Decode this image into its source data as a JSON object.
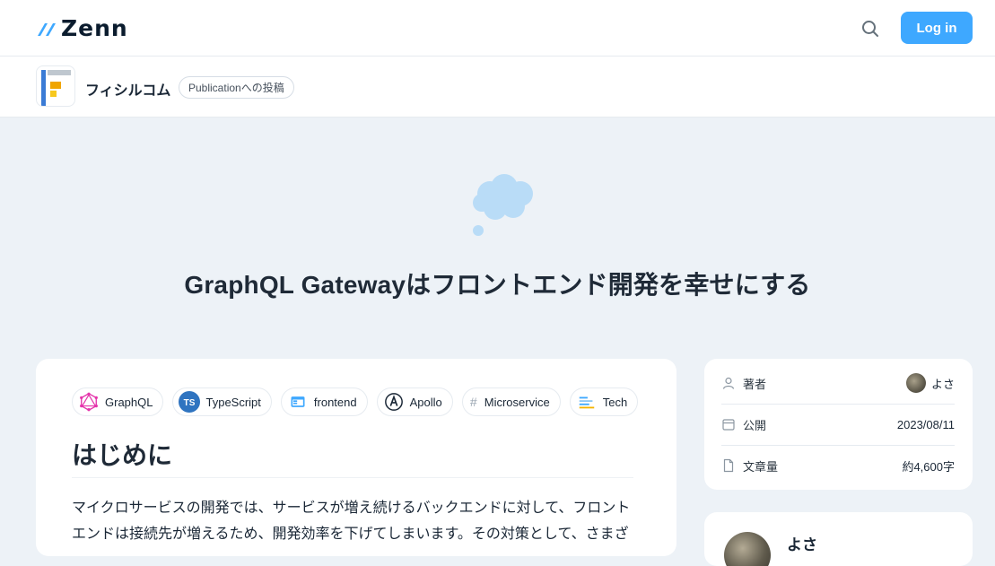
{
  "header": {
    "logo_text": "Zenn",
    "login_label": "Log in",
    "search_icon": "search-icon"
  },
  "publication": {
    "name": "フィシルコム",
    "badge": "Publicationへの投稿"
  },
  "article": {
    "emoji": "thought-balloon",
    "title": "GraphQL Gatewayはフロントエンド開発を幸せにする",
    "topics": [
      {
        "label": "GraphQL",
        "icon": "graphql-icon"
      },
      {
        "label": "TypeScript",
        "icon": "typescript-icon"
      },
      {
        "label": "frontend",
        "icon": "frontend-icon"
      },
      {
        "label": "Apollo",
        "icon": "apollo-icon"
      },
      {
        "label": "Microservice",
        "icon": "hash-icon"
      },
      {
        "label": "Tech",
        "icon": "tech-icon"
      }
    ],
    "section_heading": "はじめに",
    "paragraph": "マイクロサービスの開発では、サービスが増え続けるバックエンドに対して、フロントエンドは接続先が増えるため、開発効率を下げてしまいます。その対策として、さまざ"
  },
  "info": {
    "author_label": "著者",
    "author_name": "よさ",
    "published_label": "公開",
    "published_value": "2023/08/11",
    "length_label": "文章量",
    "length_value": "約4,600字"
  },
  "author_card": {
    "name_partial": "よさ"
  },
  "colors": {
    "accent": "#3ea8ff",
    "background": "#edf2f7"
  }
}
